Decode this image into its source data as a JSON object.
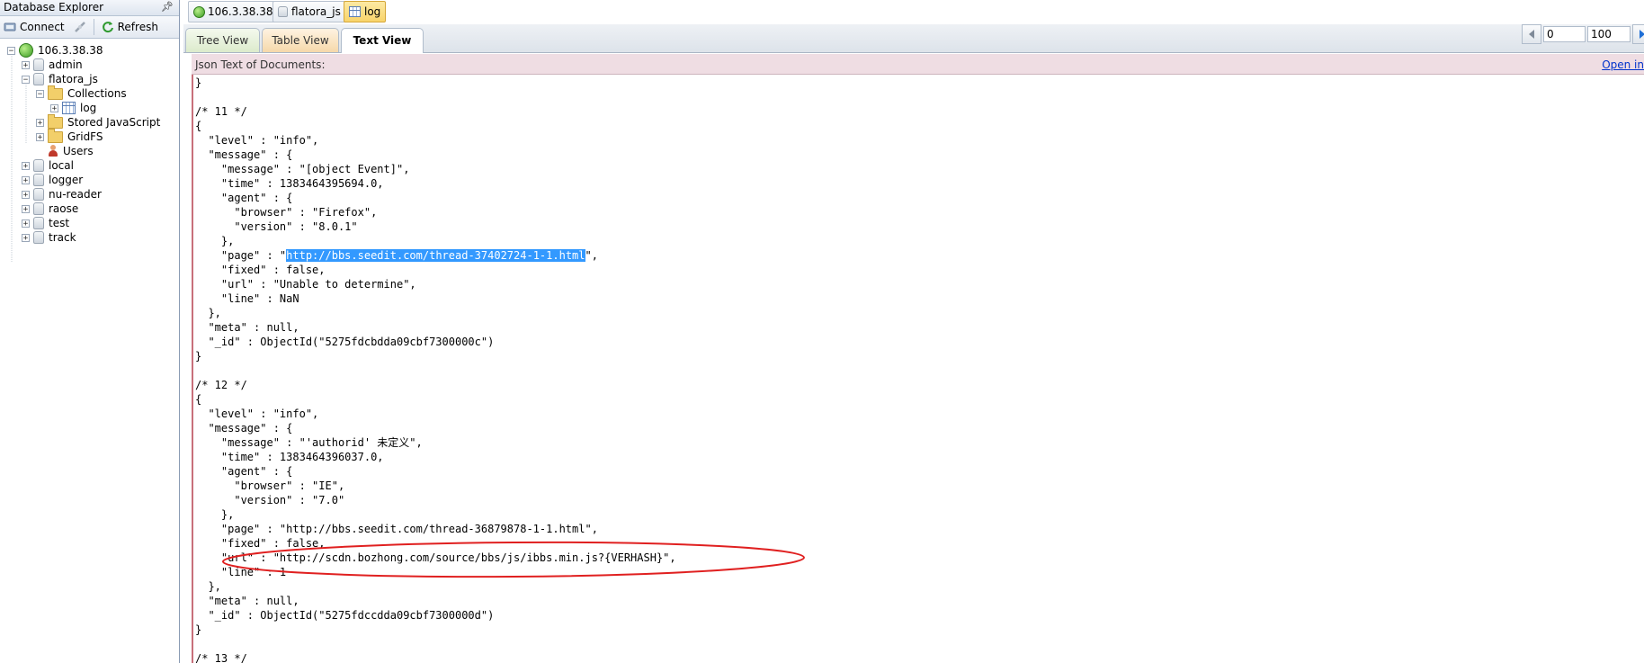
{
  "explorer": {
    "title": "Database Explorer",
    "pin_icon": "pin-icon",
    "toolbar": {
      "connect_label": "Connect",
      "refresh_label": "Refresh"
    },
    "tree": {
      "server": "106.3.38.38",
      "databases": [
        "admin",
        "flatora_js",
        "local",
        "logger",
        "nu-reader",
        "raose",
        "test",
        "track"
      ],
      "flatora_children": {
        "collections": "Collections",
        "stored_js": "Stored JavaScript",
        "gridfs": "GridFS",
        "users": "Users"
      },
      "collection_items": [
        "log"
      ]
    }
  },
  "doc_tabs": [
    "106.3.38.38",
    "flatora_js",
    "log"
  ],
  "view_tabs": {
    "tree": "Tree View",
    "table": "Table View",
    "text": "Text View",
    "active": "Text View"
  },
  "pager": {
    "skip": "0",
    "limit": "100"
  },
  "json_header": {
    "label": "Json Text of Documents:",
    "open_link": "Open in"
  },
  "json": {
    "line0": "}",
    "blank1": "",
    "doc11": {
      "comment": "/* 11 */",
      "lines_before_page": [
        "{",
        "  \"level\" : \"info\",",
        "  \"message\" : {",
        "    \"message\" : \"[object Event]\",",
        "    \"time\" : 1383464395694.0,",
        "    \"agent\" : {",
        "      \"browser\" : \"Firefox\",",
        "      \"version\" : \"8.0.1\"",
        "    },"
      ],
      "page_prefix": "    \"page\" : \"",
      "page_selected": "http://bbs.seedit.com/thread-37402724-1-1.html",
      "page_suffix": "\",",
      "lines_after_page": [
        "    \"fixed\" : false,",
        "    \"url\" : \"Unable to determine\",",
        "    \"line\" : NaN",
        "  },",
        "  \"meta\" : null,",
        "  \"_id\" : ObjectId(\"5275fdcbdda09cbf7300000c\")",
        "}"
      ]
    },
    "doc12": {
      "comment": "/* 12 */",
      "lines": [
        "{",
        "  \"level\" : \"info\",",
        "  \"message\" : {",
        "    \"message\" : \"'authorid' 未定义\",",
        "    \"time\" : 1383464396037.0,",
        "    \"agent\" : {",
        "      \"browser\" : \"IE\",",
        "      \"version\" : \"7.0\"",
        "    },",
        "    \"page\" : \"http://bbs.seedit.com/thread-36879878-1-1.html\",",
        "    \"fixed\" : false,",
        "    \"url\" : \"http://scdn.bozhong.com/source/bbs/js/ibbs.min.js?{VERHASH}\",",
        "    \"line\" : 1",
        "  },",
        "  \"meta\" : null,",
        "  \"_id\" : ObjectId(\"5275fdccdda09cbf7300000d\")",
        "}"
      ]
    },
    "doc13_comment": "/* 13 */"
  },
  "annotation": {
    "color": "#e02020",
    "shape": "ellipse"
  },
  "colors": {
    "header_bg": "#efdde3",
    "selection": "#3399ff",
    "link": "#0033cc"
  }
}
